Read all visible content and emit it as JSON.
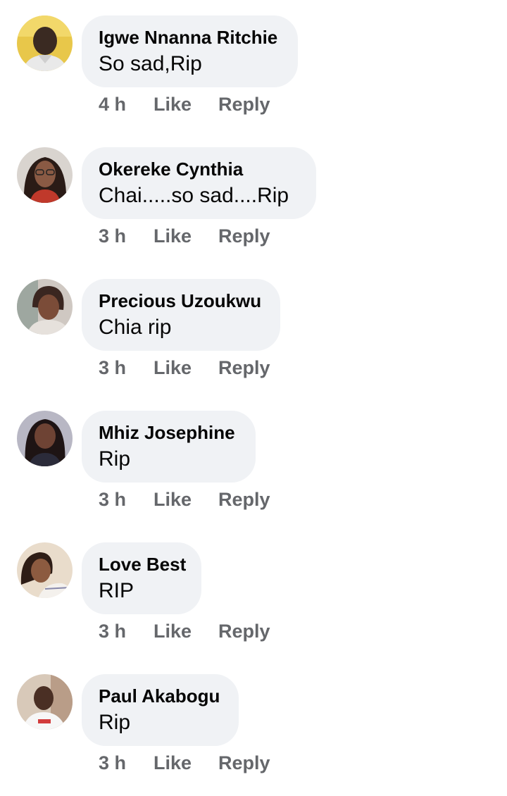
{
  "comments": [
    {
      "author": "Igwe Nnanna Ritchie",
      "text": "So sad,Rip",
      "time": "4 h",
      "like_label": "Like",
      "reply_label": "Reply",
      "avatar_icon": "profile-photo-man-yellow-bg"
    },
    {
      "author": "Okereke Cynthia",
      "text": "Chai.....so sad....Rip",
      "time": "3 h",
      "like_label": "Like",
      "reply_label": "Reply",
      "avatar_icon": "profile-photo-woman-glasses"
    },
    {
      "author": "Precious Uzoukwu",
      "text": "Chia rip",
      "time": "3 h",
      "like_label": "Like",
      "reply_label": "Reply",
      "avatar_icon": "profile-photo-woman-selfie"
    },
    {
      "author": "Mhiz Josephine",
      "text": "Rip",
      "time": "3 h",
      "like_label": "Like",
      "reply_label": "Reply",
      "avatar_icon": "profile-photo-woman-dark"
    },
    {
      "author": "Love Best",
      "text": "RIP",
      "time": "3 h",
      "like_label": "Like",
      "reply_label": "Reply",
      "avatar_icon": "profile-photo-woman-smiling"
    },
    {
      "author": "Paul Akabogu",
      "text": "Rip",
      "time": "3 h",
      "like_label": "Like",
      "reply_label": "Reply",
      "avatar_icon": "profile-photo-man-white-shirt"
    }
  ],
  "colors": {
    "bubble_bg": "#f0f2f5",
    "name_text": "#050505",
    "meta_text": "#65676b"
  }
}
